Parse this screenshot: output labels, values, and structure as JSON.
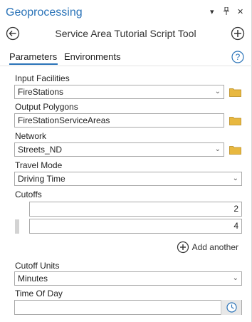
{
  "pane": {
    "title": "Geoprocessing",
    "controls": {
      "menu": "▾",
      "pin": "📌",
      "close": "✕"
    }
  },
  "tool": {
    "title": "Service Area Tutorial Script Tool"
  },
  "tabs": [
    {
      "label": "Parameters",
      "active": true
    },
    {
      "label": "Environments",
      "active": false
    }
  ],
  "params": {
    "input_facilities": {
      "label": "Input Facilities",
      "value": "FireStations"
    },
    "output_polygons": {
      "label": "Output Polygons",
      "value": "FireStationServiceAreas"
    },
    "network": {
      "label": "Network",
      "value": "Streets_ND"
    },
    "travel_mode": {
      "label": "Travel Mode",
      "value": "Driving Time"
    },
    "cutoffs": {
      "label": "Cutoffs",
      "values": [
        "2",
        "4"
      ],
      "add_label": "Add another"
    },
    "cutoff_units": {
      "label": "Cutoff Units",
      "value": "Minutes"
    },
    "time_of_day": {
      "label": "Time Of Day",
      "value": ""
    }
  },
  "colors": {
    "accent": "#2a73b8",
    "folder": "#e3b341"
  },
  "icons": [
    "back-arrow-icon",
    "add-circle-icon",
    "help-icon",
    "folder-icon",
    "chevron-down-icon",
    "clock-icon",
    "add-another-icon"
  ]
}
